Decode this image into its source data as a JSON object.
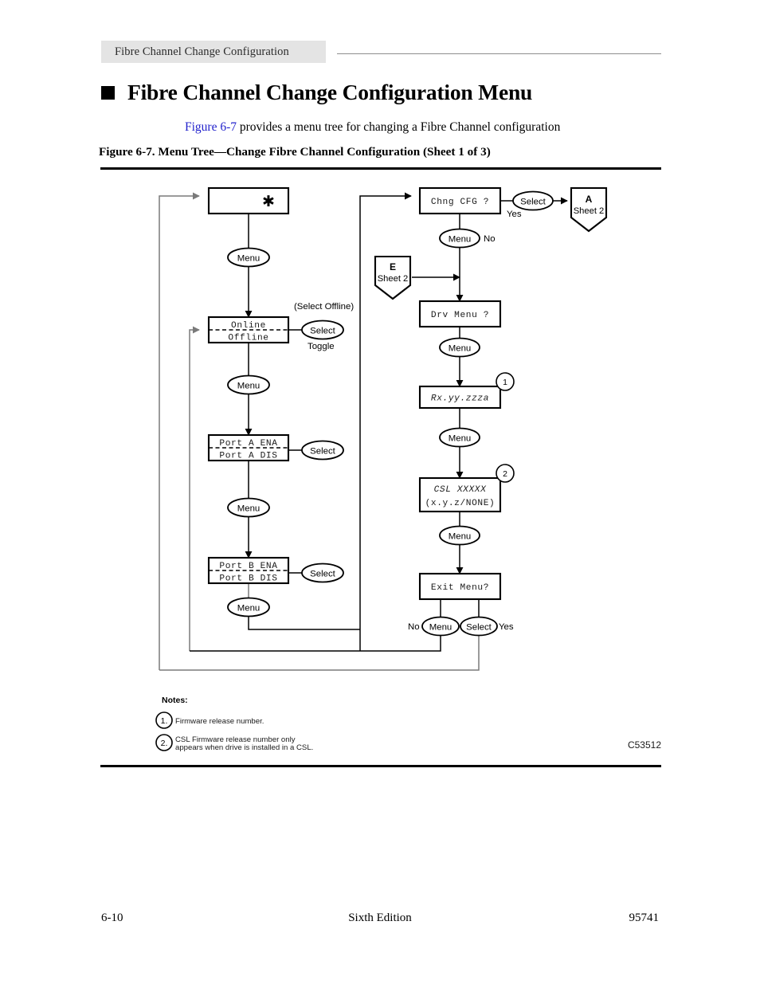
{
  "header": {
    "running_head": "Fibre Channel Change Configuration"
  },
  "title": {
    "heading": "Fibre Channel Change Configuration Menu",
    "intro_xref": "Figure 6-7",
    "intro_rest": " provides a menu tree for changing a Fibre Channel configuration",
    "figure_caption": "Figure 6-7. Menu Tree—Change Fibre Channel Configuration  (Sheet 1 of 3)"
  },
  "figure": {
    "id_label": "C53512",
    "nodes": {
      "start": {
        "glyph": "✱"
      },
      "online_offline": {
        "line1": "Online",
        "line2": "Offline"
      },
      "port_a": {
        "line1": "Port A ENA",
        "line2": "Port A DIS"
      },
      "port_b": {
        "line1": "Port B ENA",
        "line2": "Port B DIS"
      },
      "chng_cfg": {
        "line1": "Chng CFG ?"
      },
      "drv_menu": {
        "line1": "Drv Menu ?"
      },
      "rx_rev": {
        "line1": "Rx.yy.zzza"
      },
      "csl": {
        "line1": "CSL XXXXX",
        "line2": "(x.y.z/NONE)"
      },
      "exit_menu": {
        "line1": "Exit Menu?"
      }
    },
    "keys": {
      "menu": "Menu",
      "select": "Select"
    },
    "annotations": {
      "select_offline": "(Select Offline)",
      "toggle": "Toggle",
      "yes": "Yes",
      "no": "No"
    },
    "connectors": {
      "a": {
        "letter": "A",
        "sheet": "Sheet 2"
      },
      "e": {
        "letter": "E",
        "sheet": "Sheet 2"
      }
    },
    "markers": {
      "one": "1",
      "two": "2"
    },
    "notes": {
      "heading": "Notes:",
      "items": [
        {
          "num": "1.",
          "line1": "Firmware release number.",
          "line2": ""
        },
        {
          "num": "2.",
          "line1": "CSL Firmware release number only",
          "line2": "appears when drive is installed in a CSL."
        }
      ]
    }
  },
  "footer": {
    "page_number": "6-10",
    "edition": "Sixth Edition",
    "doc_number": "95741"
  }
}
